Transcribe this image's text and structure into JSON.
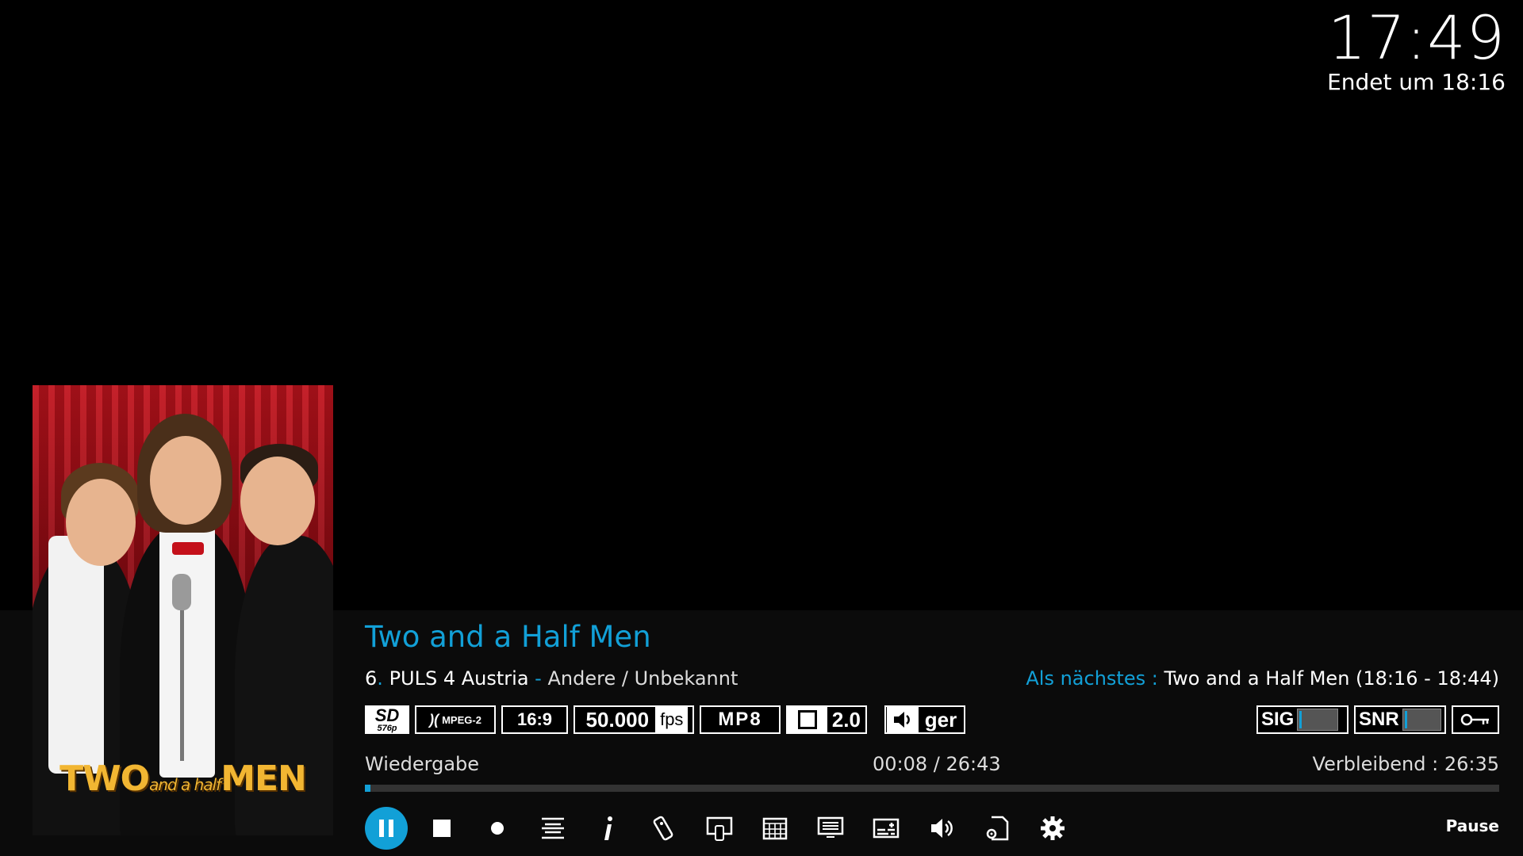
{
  "clock": {
    "time": "17:49",
    "ends": "Endet um 18:16"
  },
  "program": {
    "title": "Two and a Half Men",
    "channel_number": "6",
    "channel_name": "PULS 4 Austria",
    "separator": "-",
    "genre": "Andere / Unbekannt",
    "next_label": "Als nächstes :",
    "next_value": "Two and a Half Men (18:16 - 18:44)"
  },
  "poster": {
    "logo_two": "TWO",
    "logo_mid": "and a half",
    "logo_men": "MEN"
  },
  "flags": {
    "sd": "SD",
    "sd_res": "576p",
    "codec": "MPEG-2",
    "aspect": "16:9",
    "fps_value": "50.000",
    "fps_unit": "fps",
    "audio_codec": "MP8",
    "channels": "2.0",
    "language": "ger",
    "sig": "SIG",
    "snr": "SNR"
  },
  "meters": {
    "sig_level": 0.06,
    "snr_level": 0.06
  },
  "status": {
    "state": "Wiedergabe",
    "time": "00:08 / 26:43",
    "remaining": "Verbleibend : 26:35",
    "progress": 0.005
  },
  "controls": [
    "pause-icon",
    "stop-icon",
    "record-icon",
    "menu-lines-icon",
    "info-icon",
    "remote-icon",
    "channel-icon",
    "calendar-icon",
    "teletext-icon",
    "subtitle-icon",
    "volume-icon",
    "file-settings-icon",
    "settings-icon"
  ],
  "pause_label": "Pause",
  "colors": {
    "accent": "#12a0d7",
    "panel": "#0b0b0b"
  }
}
